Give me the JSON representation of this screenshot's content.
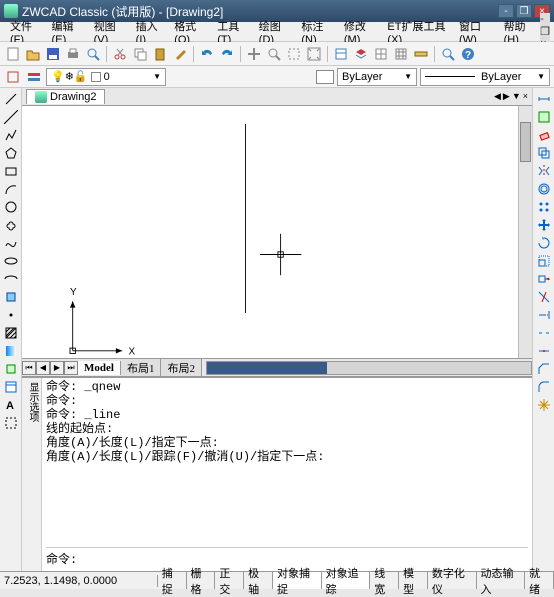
{
  "window": {
    "title": "ZWCAD Classic (试用版) - [Drawing2]",
    "minimize": "-",
    "restore": "❐",
    "close": "×"
  },
  "menu": [
    {
      "label": "文件",
      "key": "F"
    },
    {
      "label": "编辑",
      "key": "E"
    },
    {
      "label": "视图",
      "key": "V"
    },
    {
      "label": "插入",
      "key": "I"
    },
    {
      "label": "格式",
      "key": "O"
    },
    {
      "label": "工具",
      "key": "T"
    },
    {
      "label": "绘图",
      "key": "D"
    },
    {
      "label": "标注",
      "key": "N"
    },
    {
      "label": "修改",
      "key": "M"
    },
    {
      "label": "ET扩展工具",
      "key": "X"
    },
    {
      "label": "窗口",
      "key": "W"
    },
    {
      "label": "帮助",
      "key": "H"
    }
  ],
  "toolbar_icons": [
    "new",
    "open",
    "save",
    "print",
    "preview",
    "|",
    "cut",
    "copy",
    "paste",
    "brush",
    "|",
    "undo",
    "redo",
    "|",
    "pan",
    "zoom",
    "zoomwin",
    "zoomext",
    "|",
    "props",
    "layers",
    "table",
    "grid",
    "measure",
    "|",
    "zoom2",
    "help"
  ],
  "layer": {
    "current": "0",
    "color_swatch": "#ffffff",
    "bylayer1": "ByLayer",
    "bylayer2": "ByLayer"
  },
  "doc_tab": "Drawing2",
  "left_tools": [
    "line",
    "xline",
    "pline",
    "polygon",
    "rect",
    "arc",
    "circle",
    "revcloud",
    "spline",
    "ellipse",
    "ellipsearc",
    "block",
    "point",
    "hatch",
    "gradient",
    "region",
    "table2",
    "mtext",
    "boundary"
  ],
  "right_tools": [
    "dist",
    "area",
    "erase",
    "copy",
    "mirror",
    "offset",
    "array",
    "move",
    "rotate",
    "scale",
    "stretch",
    "trim",
    "extend",
    "break",
    "join",
    "chamfer",
    "fillet",
    "explode"
  ],
  "layout_tabs": {
    "model": "Model",
    "layout1": "布局1",
    "layout2": "布局2"
  },
  "command": {
    "history": "命令: _qnew\n命令:\n命令: _line\n线的起始点:\n角度(A)/长度(L)/指定下一点:\n角度(A)/长度(L)/跟踪(F)/撤消(U)/指定下一点:",
    "prompt": "命令:",
    "side": "显示选项"
  },
  "status": {
    "coords": "7.2523, 1.1498, 0.0000",
    "buttons": [
      "捕捉",
      "栅格",
      "正交",
      "极轴",
      "对象捕捉",
      "对象追踪",
      "线宽",
      "模型",
      "数字化仪",
      "动态输入",
      "就绪"
    ],
    "active": [
      4,
      5
    ]
  },
  "axis": {
    "x": "X",
    "y": "Y"
  },
  "icon_colors": {
    "new": "#f8f8d0",
    "open": "#e8c060",
    "save": "#4060c0",
    "print": "#888",
    "cut": "#c04040",
    "copy": "#888",
    "paste": "#c8a040",
    "brush": "#c08020",
    "undo": "#2080c0",
    "redo": "#2080c0",
    "pan": "#888",
    "zoom": "#888"
  }
}
